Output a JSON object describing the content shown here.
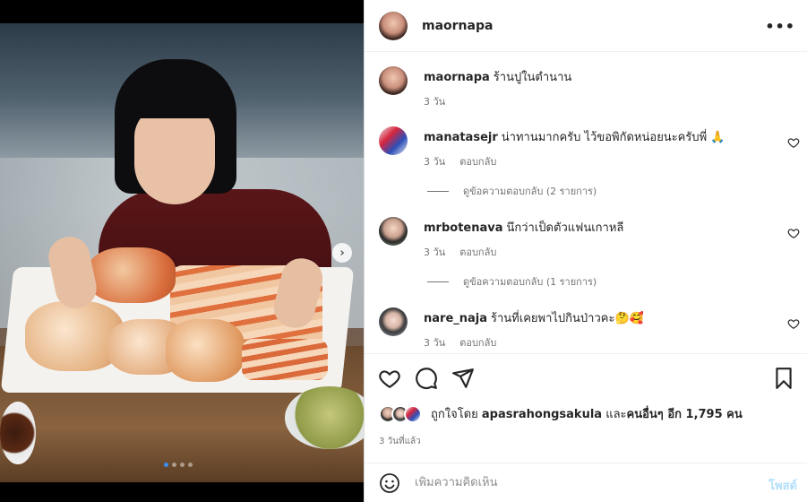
{
  "post": {
    "username": "maornapa",
    "more_icon": "more-horizontal-icon",
    "image_alt": "photo",
    "carousel": {
      "total": 4,
      "active": 0
    }
  },
  "caption": {
    "username": "maornapa",
    "text": "ร้านปูในตำนาน",
    "time": "3 วัน"
  },
  "comments": [
    {
      "username": "manatasejr",
      "text": "น่าทานมากครับ ไว้ขอพิกัดหน่อยนะครับพี่ 🙏",
      "time": "3 วัน",
      "reply_label": "ตอบกลับ",
      "view_replies": "ดูข้อความตอบกลับ (2 รายการ)"
    },
    {
      "username": "mrbotenava",
      "text": "นึกว่าเป็ดตัวแฟนเกาหลี",
      "time": "3 วัน",
      "reply_label": "ตอบกลับ",
      "view_replies": "ดูข้อความตอบกลับ (1 รายการ)"
    },
    {
      "username": "nare_naja",
      "text": "ร้านที่เคยพาไปกินป่าวคะ🤔🥰",
      "time": "3 วัน",
      "reply_label": "ตอบกลับ",
      "view_replies": ""
    }
  ],
  "likes": {
    "prefix": "ถูกใจโดย",
    "username": "apasrahongsakula",
    "suffix_and": "และ",
    "others": "คนอื่นๆ อีก 1,795 คน"
  },
  "time_ago": "3 วันที่แล้ว",
  "add_comment": {
    "placeholder": "เพิ่มความคิดเห็น",
    "post_label": "โพสต์"
  },
  "colors": {
    "text": "#262626",
    "secondary": "#737373",
    "post_disabled": "#b2dffc",
    "dot_active": "#3d8cf5"
  }
}
